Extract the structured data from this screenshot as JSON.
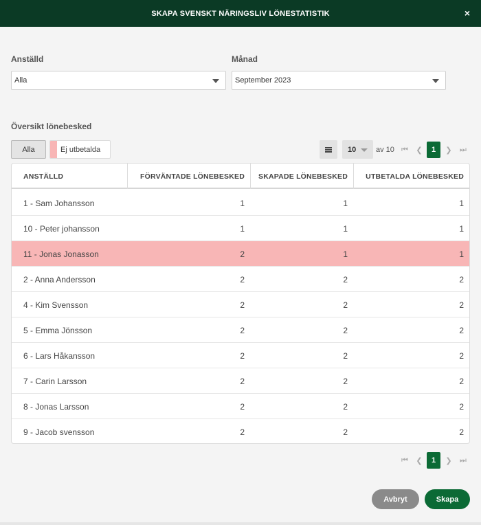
{
  "header": {
    "title": "SKAPA SVENSKT NÄRINGSLIV LÖNESTATISTIK",
    "close_icon": "×"
  },
  "filters": {
    "employee_label": "Anställd",
    "employee_value": "Alla",
    "month_label": "Månad",
    "month_value": "September 2023"
  },
  "overview": {
    "title": "Översikt lönebesked",
    "filter_all": "Alla",
    "filter_unpaid": "Ej utbetalda",
    "unpaid_color": "#f8b6b6"
  },
  "pager": {
    "page_size": "10",
    "of_label": "av 10",
    "current_page": "1"
  },
  "table": {
    "columns": [
      "ANSTÄLLD",
      "FÖRVÄNTADE LÖNEBESKED",
      "SKAPADE LÖNEBESKED",
      "UTBETALDA LÖNEBESKED"
    ],
    "rows": [
      {
        "name": "1 - Sam Johansson",
        "expected": "1",
        "created": "1",
        "paid": "1",
        "unpaid": false
      },
      {
        "name": "10 - Peter johansson",
        "expected": "1",
        "created": "1",
        "paid": "1",
        "unpaid": false
      },
      {
        "name": "11 - Jonas Jonasson",
        "expected": "2",
        "created": "1",
        "paid": "1",
        "unpaid": true
      },
      {
        "name": "2 - Anna Andersson",
        "expected": "2",
        "created": "2",
        "paid": "2",
        "unpaid": false
      },
      {
        "name": "4 - Kim Svensson",
        "expected": "2",
        "created": "2",
        "paid": "2",
        "unpaid": false
      },
      {
        "name": "5 - Emma Jönsson",
        "expected": "2",
        "created": "2",
        "paid": "2",
        "unpaid": false
      },
      {
        "name": "6 - Lars Håkansson",
        "expected": "2",
        "created": "2",
        "paid": "2",
        "unpaid": false
      },
      {
        "name": "7 - Carin Larsson",
        "expected": "2",
        "created": "2",
        "paid": "2",
        "unpaid": false
      },
      {
        "name": "8 - Jonas Larsson",
        "expected": "2",
        "created": "2",
        "paid": "2",
        "unpaid": false
      },
      {
        "name": "9 - Jacob svensson",
        "expected": "2",
        "created": "2",
        "paid": "2",
        "unpaid": false
      }
    ]
  },
  "actions": {
    "cancel_label": "Avbryt",
    "create_label": "Skapa"
  },
  "colors": {
    "header_bg": "#0b3a25",
    "accent": "#0b6a35",
    "cancel_bg": "#8a8a8a"
  }
}
